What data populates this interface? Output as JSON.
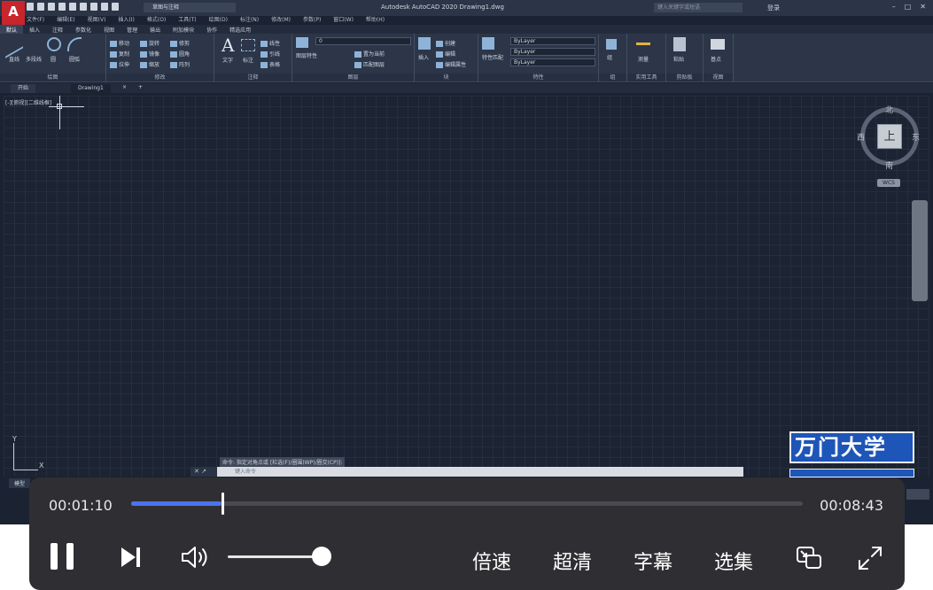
{
  "titlebar": {
    "app_logo": "A",
    "workspace": "草图与注释",
    "title": "Autodesk AutoCAD 2020    Drawing1.dwg",
    "search_placeholder": "键入关键字或短语",
    "login": "登录"
  },
  "menubar": [
    "文件(F)",
    "编辑(E)",
    "视图(V)",
    "插入(I)",
    "格式(O)",
    "工具(T)",
    "绘图(D)",
    "标注(N)",
    "修改(M)",
    "参数(P)",
    "窗口(W)",
    "帮助(H)"
  ],
  "ribbon_tabs": [
    "默认",
    "插入",
    "注释",
    "参数化",
    "视图",
    "管理",
    "输出",
    "附加模块",
    "协作",
    "精选应用"
  ],
  "ribbon": {
    "draw": {
      "label": "绘图",
      "tools": [
        "直线",
        "多段线",
        "圆",
        "圆弧"
      ]
    },
    "modify": {
      "label": "修改",
      "tools": [
        "移动",
        "旋转",
        "修剪",
        "复制",
        "镜像",
        "圆角",
        "拉伸",
        "缩放",
        "阵列"
      ]
    },
    "annotation": {
      "label": "注释",
      "tools": [
        "文字",
        "标注",
        "线性",
        "引线",
        "表格"
      ],
      "big_letter": "A"
    },
    "layers": {
      "label": "图层",
      "tools": [
        "图层特性",
        "置为当前",
        "匹配图层"
      ],
      "layer_value": "0"
    },
    "block": {
      "label": "块",
      "tools": [
        "插入",
        "创建",
        "编辑",
        "编辑属性"
      ]
    },
    "properties": {
      "label": "特性",
      "tools": [
        "特性匹配"
      ],
      "combo1": "ByLayer",
      "combo2": "ByLayer",
      "combo3": "ByLayer"
    },
    "groups": {
      "label": "组",
      "tools": [
        "组"
      ]
    },
    "utilities": {
      "label": "实用工具",
      "tools": [
        "测量"
      ]
    },
    "clipboard": {
      "label": "剪贴板",
      "tools": [
        "粘贴"
      ]
    },
    "view": {
      "label": "视图",
      "tools": [
        "基点"
      ]
    }
  },
  "doc_tabs": {
    "start": "开始",
    "drawing": "Drawing1"
  },
  "viewport": {
    "label": "[-][俯视][二维线框]",
    "compass": {
      "north": "北",
      "south": "南",
      "east": "东",
      "west": "西",
      "face": "上"
    },
    "wcs": "WCS",
    "ucs_y": "Y",
    "ucs_x": "X"
  },
  "command": {
    "history": "命令: 指定对角点或 [栏选(F)/圈围(WP)/圈交(CP)]:",
    "placeholder": "键入命令"
  },
  "model_tab": "模型",
  "watermark": "万门大学",
  "player": {
    "current_time": "00:01:10",
    "total_time": "00:08:43",
    "progress": 0.134,
    "volume": 0.95,
    "buttons": {
      "speed": "倍速",
      "quality": "超清",
      "subtitles": "字幕",
      "episodes": "选集"
    },
    "accent": "#4d72f1"
  }
}
